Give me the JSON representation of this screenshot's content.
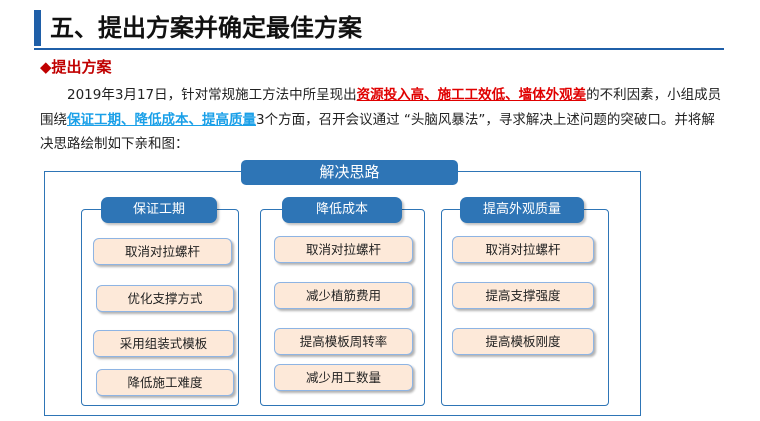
{
  "heading": "五、提出方案并确定最佳方案",
  "subheading": "◆提出方案",
  "paragraph": {
    "p1": "2019年3月17日，针对常规施工方法中所呈现出",
    "red": "资源投入高、施工工效低、墙体外观差",
    "p2": "的不利因素，小组成员围绕",
    "blue": "保证工期、降低成本、提高质量",
    "p3": "3个方面，召开会议通过 “头脑风暴法”，寻求解决上述问题的突破口。并将解决思路绘制如下亲和图："
  },
  "diagram": {
    "title": "解决思路",
    "groups": [
      {
        "label": "保证工期",
        "items": [
          "取消对拉螺杆",
          "优化支撑方式",
          "采用组装式模板",
          "降低施工难度"
        ]
      },
      {
        "label": "降低成本",
        "items": [
          "取消对拉螺杆",
          "减少植筋费用",
          "提高模板周转率",
          "减少用工数量"
        ]
      },
      {
        "label": "提高外观质量",
        "items": [
          "取消对拉螺杆",
          "提高支撑强度",
          "提高模板刚度"
        ]
      }
    ]
  },
  "colors": {
    "accent": "#2e75b6",
    "item_fill": "#fde9d9",
    "emphasis_red": "#e00000",
    "emphasis_blue": "#1aa0e8"
  }
}
